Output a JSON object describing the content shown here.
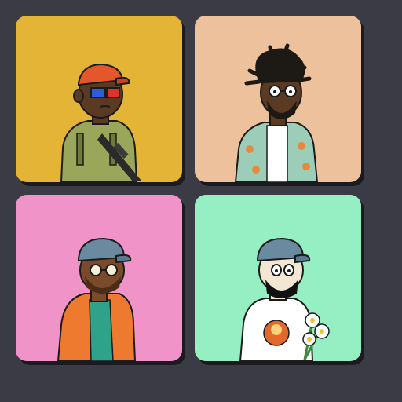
{
  "gallery": {
    "cards": [
      {
        "background": "#e3b436",
        "skin": "#5b3a24",
        "cap": "#e4572b",
        "outfit": "#9aa65a",
        "glasses": "3d-glasses",
        "accessory": "rifle"
      },
      {
        "background": "#ecc19b",
        "skin": "#5a3a22",
        "hair": "#1d1a16",
        "outfit": "#9ccdb9",
        "pattern": "#e48a3c",
        "glasses": "round-glasses",
        "accessory": "beard"
      },
      {
        "background": "#ef93c9",
        "skin": "#7a4a2a",
        "cap": "#6a8aa0",
        "outfit": "#ee7a2f",
        "shirt": "#2fa38a",
        "glasses": "round-glasses",
        "accessory": "beard"
      },
      {
        "background": "#96efc3",
        "skin": "#f1e7d3",
        "cap": "#6a8aa0",
        "outfit": "#ffffff",
        "print": "#e4682b",
        "glasses": "none",
        "accessory": "daisies"
      }
    ]
  }
}
